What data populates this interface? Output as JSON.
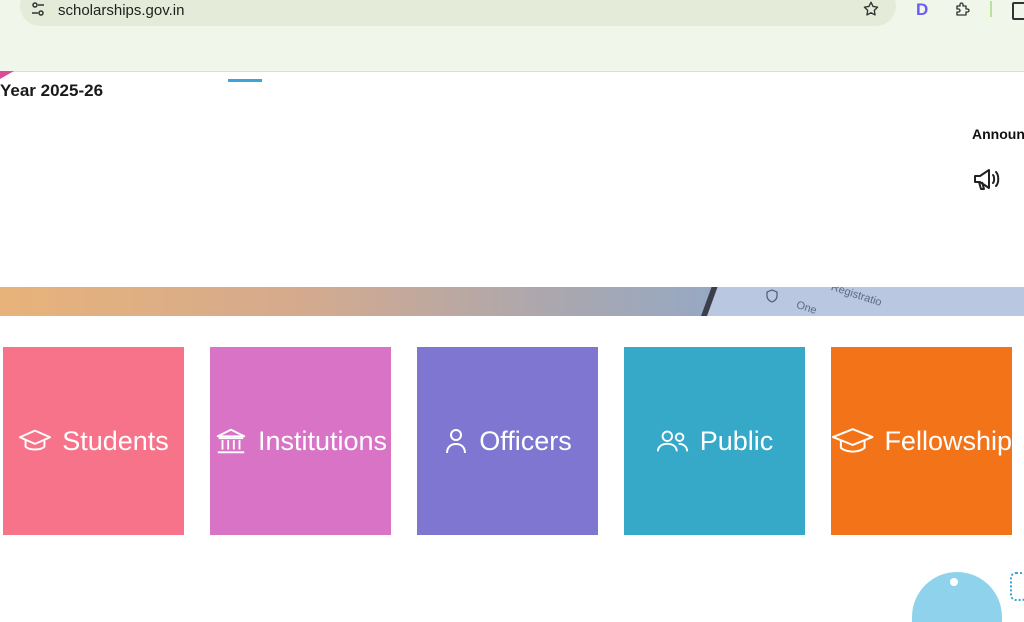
{
  "browser": {
    "url": "scholarships.gov.in",
    "extension_badge": "D"
  },
  "page": {
    "year_label": "Year 2025-26",
    "announcements_title": "Announ"
  },
  "banner": {
    "text_1": "Registratio",
    "text_2": "One"
  },
  "tiles": [
    {
      "label": "Students",
      "icon": "graduation-cap-icon",
      "color": "#f7738a"
    },
    {
      "label": "Institutions",
      "icon": "bank-building-icon",
      "color": "#d973c6"
    },
    {
      "label": "Officers",
      "icon": "user-icon",
      "color": "#7f76d2"
    },
    {
      "label": "Public",
      "icon": "users-icon",
      "color": "#36a9c9"
    },
    {
      "label": "Fellowship",
      "icon": "graduation-cap-icon",
      "color": "#f37319"
    }
  ]
}
